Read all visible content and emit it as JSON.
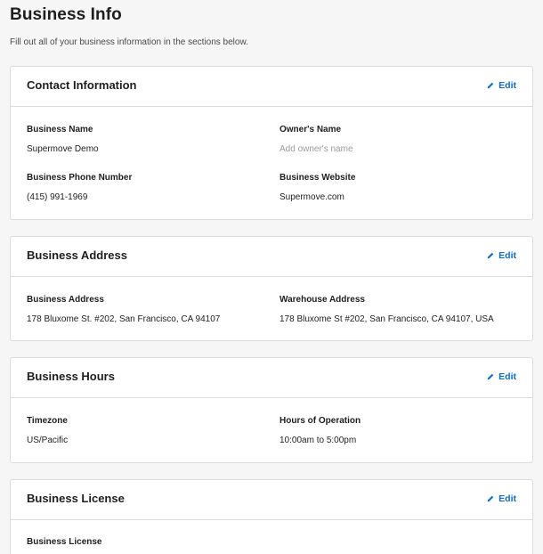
{
  "page": {
    "title": "Business Info",
    "subtitle": "Fill out all of your business information in the sections below."
  },
  "colors": {
    "accent": "#0b6bd4",
    "placeholder": "#9b9ba1",
    "border": "#dcdcdf"
  },
  "sections": {
    "contact": {
      "title": "Contact Information",
      "edit_label": "Edit",
      "business_name_label": "Business Name",
      "business_name_value": "Supermove Demo",
      "owner_name_label": "Owner's Name",
      "owner_name_placeholder": "Add owner's name",
      "phone_label": "Business Phone Number",
      "phone_value": "(415) 991-1969",
      "website_label": "Business Website",
      "website_value": "Supermove.com"
    },
    "address": {
      "title": "Business Address",
      "edit_label": "Edit",
      "business_address_label": "Business Address",
      "business_address_value": "178 Bluxome St. #202, San Francisco, CA 94107",
      "warehouse_address_label": "Warehouse Address",
      "warehouse_address_value": "178 Bluxome St #202, San Francisco, CA 94107, USA"
    },
    "hours": {
      "title": "Business Hours",
      "edit_label": "Edit",
      "timezone_label": "Timezone",
      "timezone_value": "US/Pacific",
      "hours_label": "Hours of Operation",
      "hours_value": "10:00am to 5:00pm"
    },
    "license": {
      "title": "Business License",
      "edit_label": "Edit",
      "license_label": "Business License"
    }
  },
  "icons": {
    "edit": "pencil-icon"
  }
}
